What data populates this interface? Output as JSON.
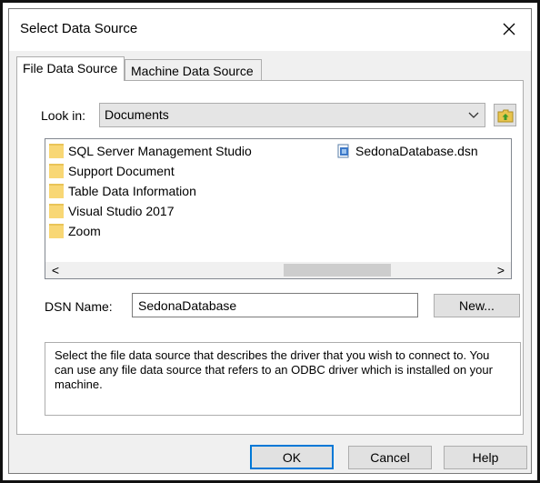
{
  "dialog": {
    "title": "Select Data Source",
    "close_glyph": "✕"
  },
  "tabs": [
    {
      "label": "File Data Source",
      "active": true
    },
    {
      "label": "Machine Data Source",
      "active": false
    }
  ],
  "look_in": {
    "label": "Look in:",
    "value": "Documents",
    "dropdown_glyph": "⌵",
    "up_folder_icon": "folder-up-icon"
  },
  "file_list": {
    "folders": [
      "SQL Server Management Studio",
      "Support Document",
      "Table Data Information",
      "Visual Studio 2017",
      "Zoom"
    ],
    "files": [
      "SedonaDatabase.dsn"
    ],
    "scroll_left": "<",
    "scroll_right": ">"
  },
  "dsn": {
    "label": "DSN Name:",
    "value": "SedonaDatabase",
    "new_button": "New..."
  },
  "description": "Select the file data source that describes the driver that you wish to connect to. You can use any file data source that refers to an ODBC driver which is installed on your machine.",
  "buttons": {
    "ok": "OK",
    "cancel": "Cancel",
    "help": "Help"
  },
  "colors": {
    "accent": "#0078d7",
    "folder": "#f8d775",
    "dialog_bg": "#f0f0f0"
  }
}
